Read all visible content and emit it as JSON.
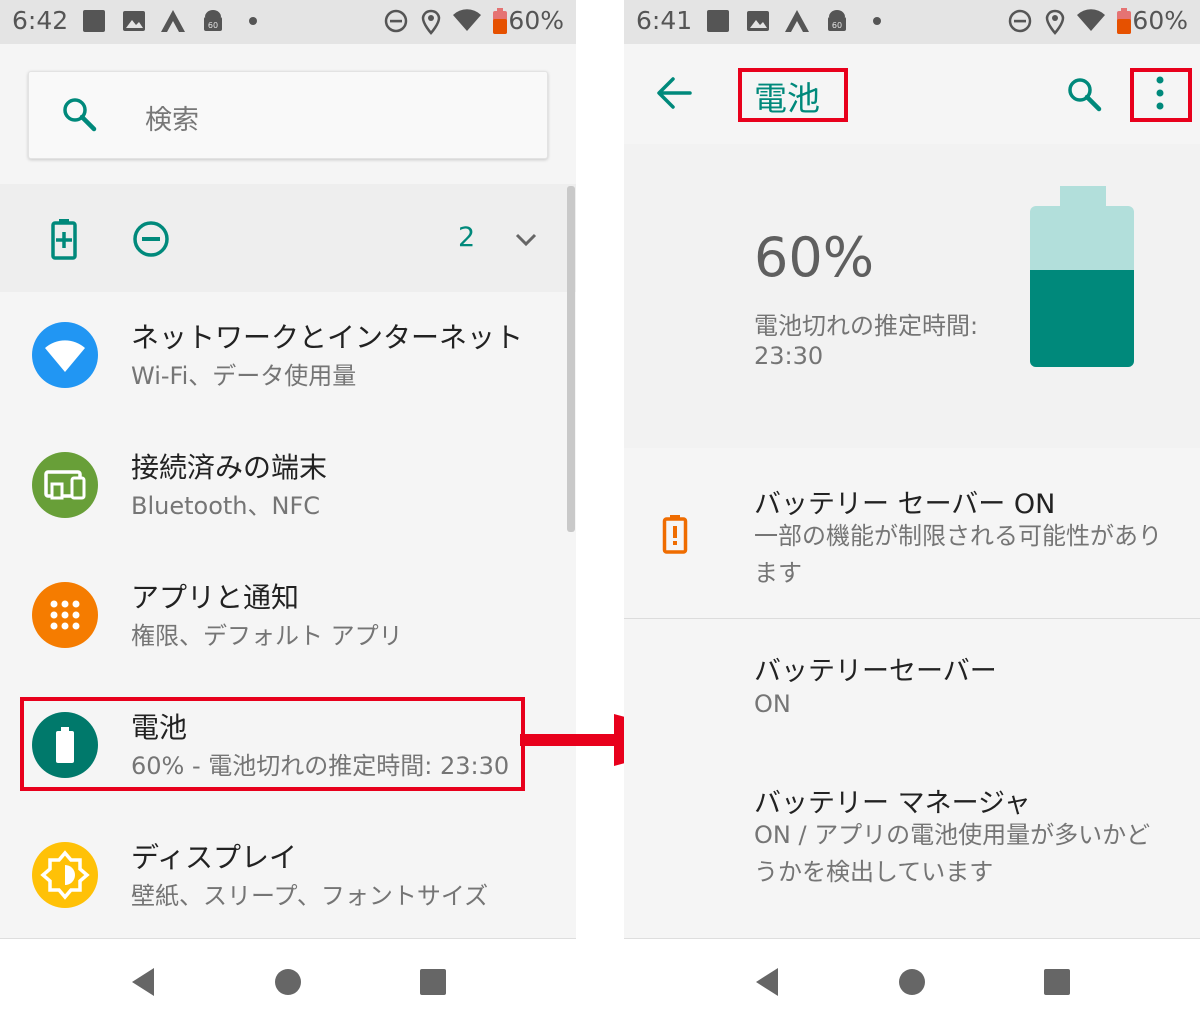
{
  "left": {
    "status": {
      "time": "6:42",
      "battery": "60%"
    },
    "search": {
      "placeholder": "検索"
    },
    "conditions": {
      "count": "2"
    },
    "items": [
      {
        "title": "ネットワークとインターネット",
        "subtitle": "Wi-Fi、データ使用量",
        "icon": "wifi-icon",
        "color": "#2196f3"
      },
      {
        "title": "接続済みの端末",
        "subtitle": "Bluetooth、NFC",
        "icon": "devices-icon",
        "color": "#689f38"
      },
      {
        "title": "アプリと通知",
        "subtitle": "権限、デフォルト アプリ",
        "icon": "apps-icon",
        "color": "#f57c00"
      },
      {
        "title": "電池",
        "subtitle": "60% - 電池切れの推定時間: 23:30",
        "icon": "battery-icon",
        "color": "#00796b",
        "highlighted": true
      },
      {
        "title": "ディスプレイ",
        "subtitle": "壁紙、スリープ、フォントサイズ",
        "icon": "brightness-icon",
        "color": "#ffc107"
      }
    ]
  },
  "right": {
    "status": {
      "time": "6:41",
      "battery": "60%"
    },
    "appbar": {
      "title": "電池"
    },
    "header": {
      "percent": "60%",
      "estimate_label": "電池切れの推定時間:",
      "estimate_time": "23:30",
      "level": 0.6
    },
    "items": [
      {
        "title": "バッテリー セーバー ON",
        "subtitle": "一部の機能が制限される可能性があります"
      },
      {
        "title": "バッテリーセーバー",
        "subtitle": "ON"
      },
      {
        "title": "バッテリー マネージャ",
        "subtitle": "ON / アプリの電池使用量が多いかどうかを検出しています"
      }
    ]
  },
  "colors": {
    "accent": "#00897b",
    "highlight": "#e8001c",
    "saver": "#ef6c00"
  }
}
